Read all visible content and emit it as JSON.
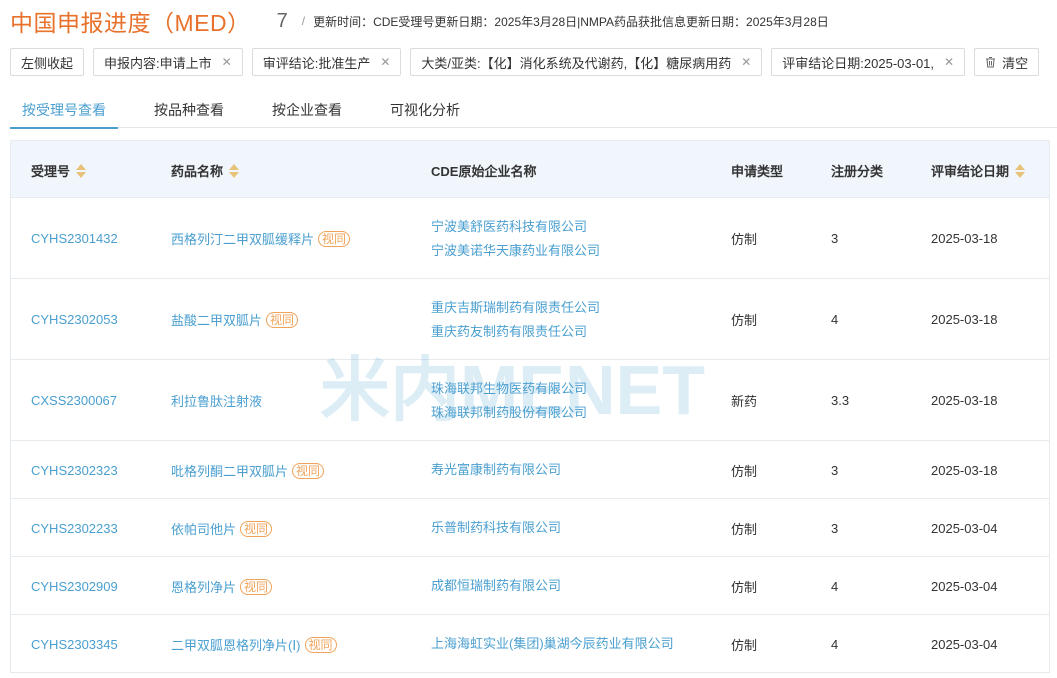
{
  "header": {
    "title": "中国申报进度（MED）",
    "count": "7",
    "separator": "/",
    "update_info": "更新时间：CDE受理号更新日期：2025年3月28日|NMPA药品获批信息更新日期：2025年3月28日"
  },
  "filters": {
    "collapse_label": "左侧收起",
    "chips": [
      "申报内容:申请上市",
      "审评结论:批准生产",
      "大类/亚类:【化】消化系统及代谢药,【化】糖尿病用药",
      "评审结论日期:2025-03-01,"
    ],
    "clear_label": "清空",
    "close_glyph": "✕"
  },
  "tabs": [
    "按受理号查看",
    "按品种查看",
    "按企业查看",
    "可视化分析"
  ],
  "table": {
    "columns": [
      "受理号",
      "药品名称",
      "CDE原始企业名称",
      "申请类型",
      "注册分类",
      "评审结论日期"
    ],
    "rows": [
      {
        "id": "CYHS2301432",
        "drug": "西格列汀二甲双胍缓释片",
        "tag": "视同",
        "companies": [
          "宁波美舒医药科技有限公司",
          "宁波美诺华天康药业有限公司"
        ],
        "type": "仿制",
        "class": "3",
        "date": "2025-03-18"
      },
      {
        "id": "CYHS2302053",
        "drug": "盐酸二甲双胍片",
        "tag": "视同",
        "companies": [
          "重庆吉斯瑞制药有限责任公司",
          "重庆药友制药有限责任公司"
        ],
        "type": "仿制",
        "class": "4",
        "date": "2025-03-18"
      },
      {
        "id": "CXSS2300067",
        "drug": "利拉鲁肽注射液",
        "tag": "",
        "companies": [
          "珠海联邦生物医药有限公司",
          "珠海联邦制药股份有限公司"
        ],
        "type": "新药",
        "class": "3.3",
        "date": "2025-03-18"
      },
      {
        "id": "CYHS2302323",
        "drug": "吡格列酮二甲双胍片",
        "tag": "视同",
        "companies": [
          "寿光富康制药有限公司"
        ],
        "type": "仿制",
        "class": "3",
        "date": "2025-03-18"
      },
      {
        "id": "CYHS2302233",
        "drug": "依帕司他片",
        "tag": "视同",
        "companies": [
          "乐普制药科技有限公司"
        ],
        "type": "仿制",
        "class": "3",
        "date": "2025-03-04"
      },
      {
        "id": "CYHS2302909",
        "drug": "恩格列净片",
        "tag": "视同",
        "companies": [
          "成都恒瑞制药有限公司"
        ],
        "type": "仿制",
        "class": "4",
        "date": "2025-03-04"
      },
      {
        "id": "CYHS2303345",
        "drug": "二甲双胍恩格列净片(Ⅰ)",
        "tag": "视同",
        "companies": [
          "上海海虹实业(集团)巢湖今辰药业有限公司"
        ],
        "type": "仿制",
        "class": "4",
        "date": "2025-03-04"
      }
    ]
  },
  "watermark": {
    "text": "米内MENET"
  },
  "colors": {
    "accent": "#4a9fd0",
    "title": "#e8712b",
    "tag": "#f0a35a",
    "header_bg": "#f0f6fb"
  }
}
